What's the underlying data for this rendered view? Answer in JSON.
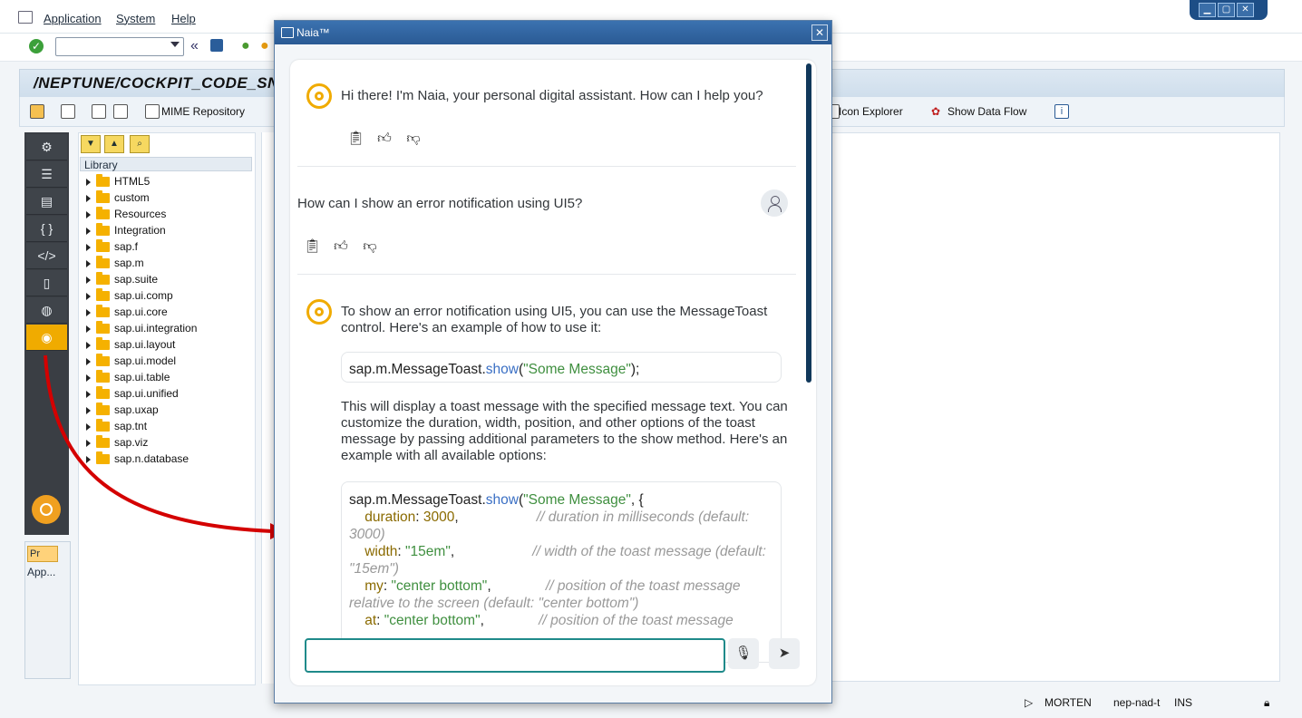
{
  "menubar": {
    "items": [
      "Application",
      "System",
      "Help"
    ]
  },
  "page": {
    "title": "/NEPTUNE/COCKPIT_CODE_SN"
  },
  "app_toolbar": {
    "mime": "MIME Repository",
    "icon_explorer": "Icon Explorer",
    "show_data_flow": "Show Data Flow"
  },
  "library": {
    "header": "Library",
    "items": [
      "HTML5",
      "custom",
      "Resources",
      "Integration",
      "sap.f",
      "sap.m",
      "sap.suite",
      "sap.ui.comp",
      "sap.ui.core",
      "sap.ui.integration",
      "sap.ui.layout",
      "sap.ui.model",
      "sap.ui.table",
      "sap.ui.unified",
      "sap.uxap",
      "sap.tnt",
      "sap.viz",
      "sap.n.database"
    ]
  },
  "sidebar_bottom": {
    "pr": "Pr",
    "app": "App..."
  },
  "dialog": {
    "title": "Naia™",
    "close": "✕",
    "messages": {
      "greeting": "Hi there! I'm Naia, your personal digital assistant. How can I help you?",
      "question": "How can I show an error notification using UI5?",
      "answer_intro": "To show an error notification using UI5, you can use the MessageToast control. Here's an example of how to use it:",
      "answer_mid": "This will display a toast message with the specified message text. You can customize the duration, width, position, and other options of the toast message by passing additional parameters to the show method. Here's an example with all available options:"
    },
    "code1": {
      "obj": "sap.m.MessageToast.",
      "fn": "show",
      "open": "(",
      "str": "\"Some Message\"",
      "close": ");"
    },
    "code2": {
      "line1_obj": "sap.m.MessageToast.",
      "line1_fn": "show",
      "line1_open": "(",
      "line1_str": "\"Some Message\"",
      "line1_rest": ", {",
      "k1": "duration",
      "v1": "3000",
      "c1": "// duration in milliseconds (default: 3000)",
      "k2": "width",
      "v2": "\"15em\"",
      "c2": "// width of the toast message (default: \"15em\")",
      "k3": "my",
      "v3": "\"center bottom\"",
      "c3": "// position of the toast message relative to the screen (default: \"center bottom\")",
      "k4": "at",
      "v4": "\"center bottom\"",
      "c4": "// position of the toast message"
    },
    "input": {
      "value": "",
      "placeholder": ""
    }
  },
  "status": {
    "user": "MORTEN",
    "system": "nep-nad-t",
    "mode": "INS"
  },
  "colors": {
    "naia_accent": "#f0ab00",
    "title_blue": "#2a5a94",
    "arrow_red": "#d40000"
  }
}
